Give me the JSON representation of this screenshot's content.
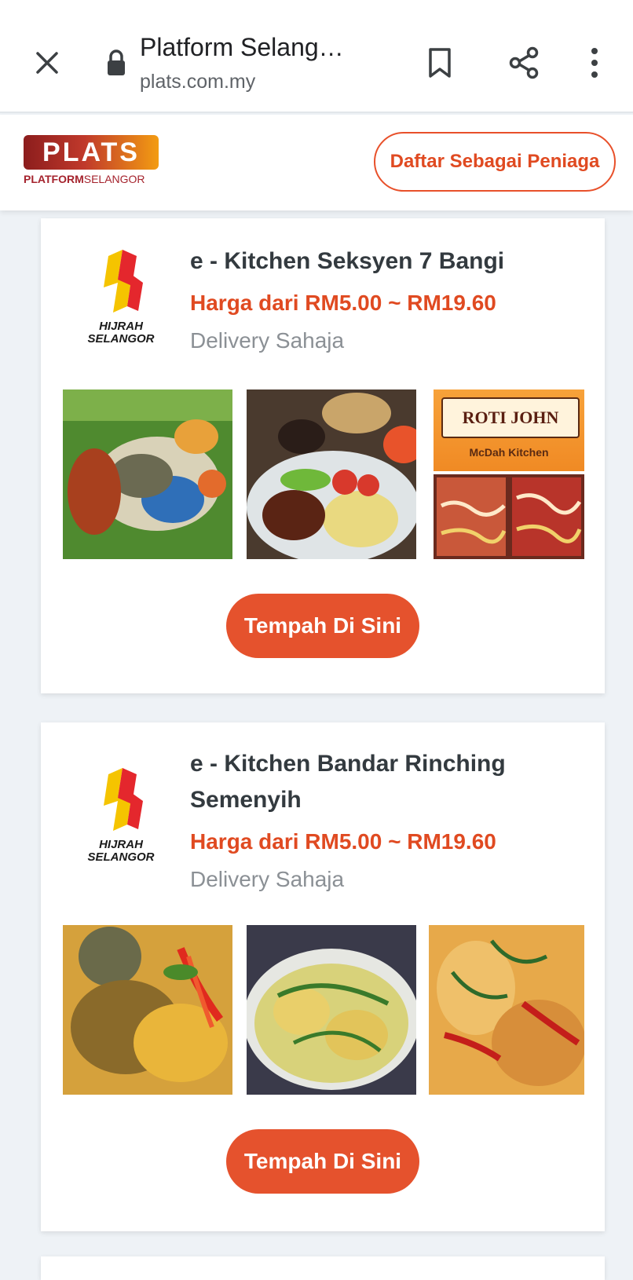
{
  "browser": {
    "title": "Platform Selang…",
    "url": "plats.com.my"
  },
  "site": {
    "logo_text": "PLATS",
    "logo_sub_bold": "PLATFORM",
    "logo_sub": "SELANGOR",
    "register_label": "Daftar Sebagai Peniaga"
  },
  "listings": [
    {
      "badge_line1": "HIJRAH",
      "badge_line2": "SELANGOR",
      "name": "e - Kitchen Seksyen 7 Bangi",
      "price": "Harga dari RM5.00 ~ RM19.60",
      "delivery": "Delivery Sahaja",
      "promo_title": "ROTI JOHN",
      "promo_sub": "McDah Kitchen",
      "button_label": "Tempah Di Sini"
    },
    {
      "badge_line1": "HIJRAH",
      "badge_line2": "SELANGOR",
      "name": "e - Kitchen Bandar Rinching Semenyih",
      "price": "Harga dari RM5.00 ~ RM19.60",
      "delivery": "Delivery Sahaja",
      "button_label": "Tempah Di Sini"
    }
  ],
  "colors": {
    "accent": "#e5522d",
    "price": "#e04a21",
    "heading": "#333a3f",
    "muted": "#8b9095"
  }
}
